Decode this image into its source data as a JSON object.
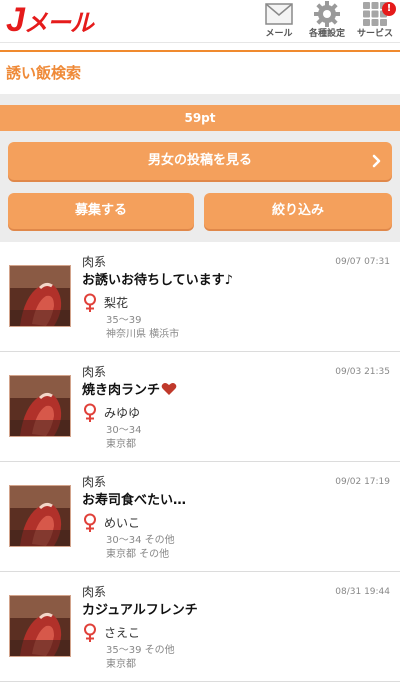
{
  "header": {
    "logo": {
      "j": "J",
      "rest": "メール"
    },
    "nav": [
      {
        "label": "メール",
        "icon": "mail-icon"
      },
      {
        "label": "各種設定",
        "icon": "gear-icon"
      },
      {
        "label": "サービス",
        "icon": "grid-icon",
        "badge": "!"
      }
    ]
  },
  "page": {
    "title": "誘い飯検索",
    "points": "59pt",
    "buttons": {
      "view_posts": "男女の投稿を見る",
      "recruit": "募集する",
      "filter": "絞り込み"
    }
  },
  "colors": {
    "brand_red": "#e51b1b",
    "accent_orange": "#f4a05c",
    "title_orange": "#ef8a38",
    "female_icon": "#e0413a"
  },
  "posts": [
    {
      "category": "肉系",
      "title": "お誘いお待ちしています♪",
      "has_heart": false,
      "gender_icon": "female-icon",
      "username": "梨花",
      "age": "35～39",
      "area": "神奈川県 横浜市",
      "datetime": "09/07 07:31"
    },
    {
      "category": "肉系",
      "title": "焼き肉ランチ",
      "has_heart": true,
      "gender_icon": "female-icon",
      "username": "みゆゆ",
      "age": "30～34",
      "area": "東京都",
      "datetime": "09/03 21:35"
    },
    {
      "category": "肉系",
      "title": "お寿司食べたい…",
      "has_heart": false,
      "gender_icon": "female-icon",
      "username": "めいこ",
      "age": "30～34 その他",
      "area": "東京都 その他",
      "datetime": "09/02 17:19"
    },
    {
      "category": "肉系",
      "title": "カジュアルフレンチ",
      "has_heart": false,
      "gender_icon": "female-icon",
      "username": "さえこ",
      "age": "35～39 その他",
      "area": "東京都",
      "datetime": "08/31 19:44"
    }
  ]
}
